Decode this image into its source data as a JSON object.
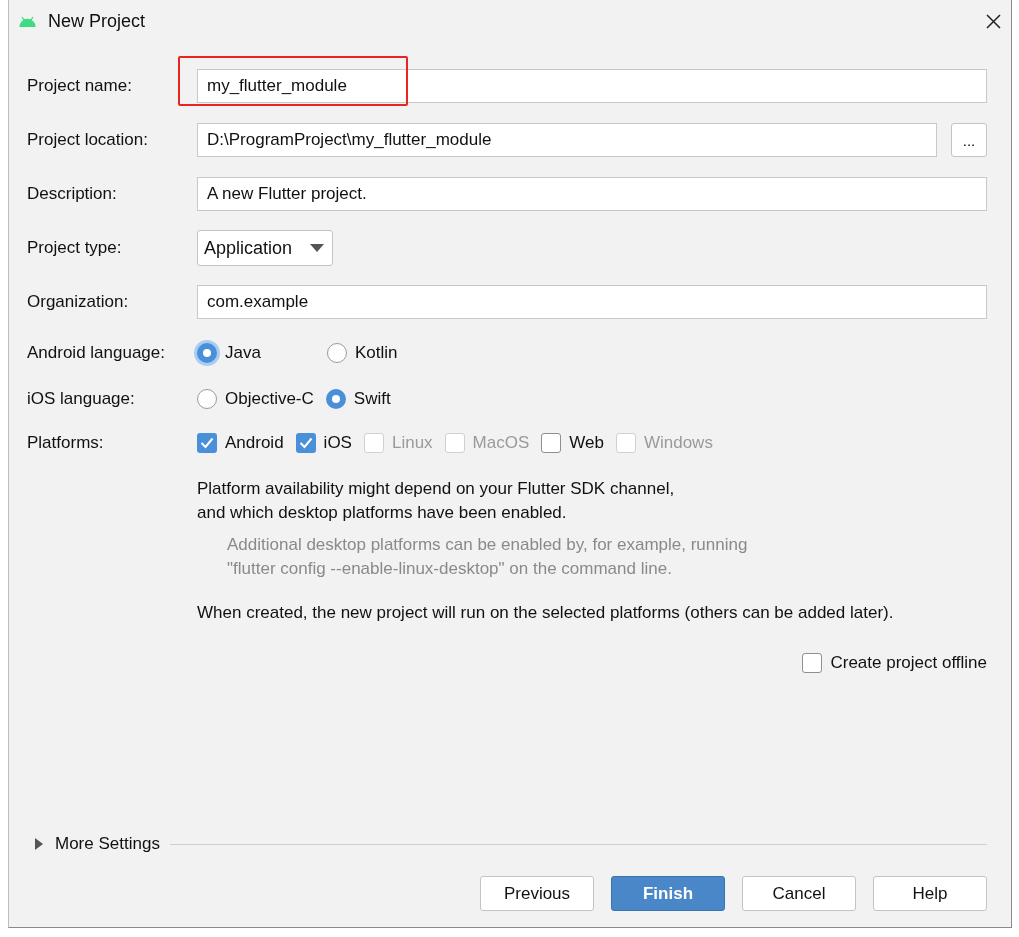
{
  "window": {
    "title": "New Project"
  },
  "fields": [
    {
      "kind": "text",
      "label": "Project name:",
      "value": "my_flutter_module",
      "highlighted": true
    },
    {
      "kind": "path",
      "label": "Project location:",
      "value": "D:\\ProgramProject\\my_flutter_module",
      "browse": "...",
      "highlighted": false
    },
    {
      "kind": "text",
      "label": "Description:",
      "value": "A new Flutter project.",
      "highlighted": false
    },
    {
      "kind": "dropdown",
      "label": "Project type:",
      "value": "Application",
      "highlighted": false
    },
    {
      "kind": "text",
      "label": "Organization:",
      "value": "com.example",
      "highlighted": false
    }
  ],
  "radio_groups": [
    {
      "label": "Android language:",
      "options": [
        {
          "label": "Java",
          "selected": true,
          "focused": true
        },
        {
          "label": "Kotlin",
          "selected": false,
          "focused": false
        }
      ]
    },
    {
      "label": "iOS language:",
      "options": [
        {
          "label": "Objective-C",
          "selected": false,
          "focused": false
        },
        {
          "label": "Swift",
          "selected": true,
          "focused": false
        }
      ]
    }
  ],
  "platforms": {
    "label": "Platforms:",
    "options": [
      {
        "label": "Android",
        "checked": true,
        "disabled": false
      },
      {
        "label": "iOS",
        "checked": true,
        "disabled": false
      },
      {
        "label": "Linux",
        "checked": false,
        "disabled": true
      },
      {
        "label": "MacOS",
        "checked": false,
        "disabled": true
      },
      {
        "label": "Web",
        "checked": false,
        "disabled": false
      },
      {
        "label": "Windows",
        "checked": false,
        "disabled": true
      }
    ]
  },
  "notes": [
    {
      "kind": "plain",
      "text": "Platform availability might depend on your Flutter SDK channel,\nand which desktop platforms have been enabled."
    },
    {
      "kind": "hint",
      "text": "Additional desktop platforms can be enabled by, for example, running\n\"flutter config --enable-linux-desktop\" on the command line."
    },
    {
      "kind": "plain",
      "text": "When created, the new project will run on the selected platforms (others can be added later)."
    }
  ],
  "offline": {
    "label": "Create project offline",
    "checked": false
  },
  "more_settings": {
    "label": "More Settings",
    "expanded": false
  },
  "buttons": [
    {
      "label": "Previous",
      "primary": false
    },
    {
      "label": "Finish",
      "primary": true
    },
    {
      "label": "Cancel",
      "primary": false
    },
    {
      "label": "Help",
      "primary": false
    }
  ]
}
